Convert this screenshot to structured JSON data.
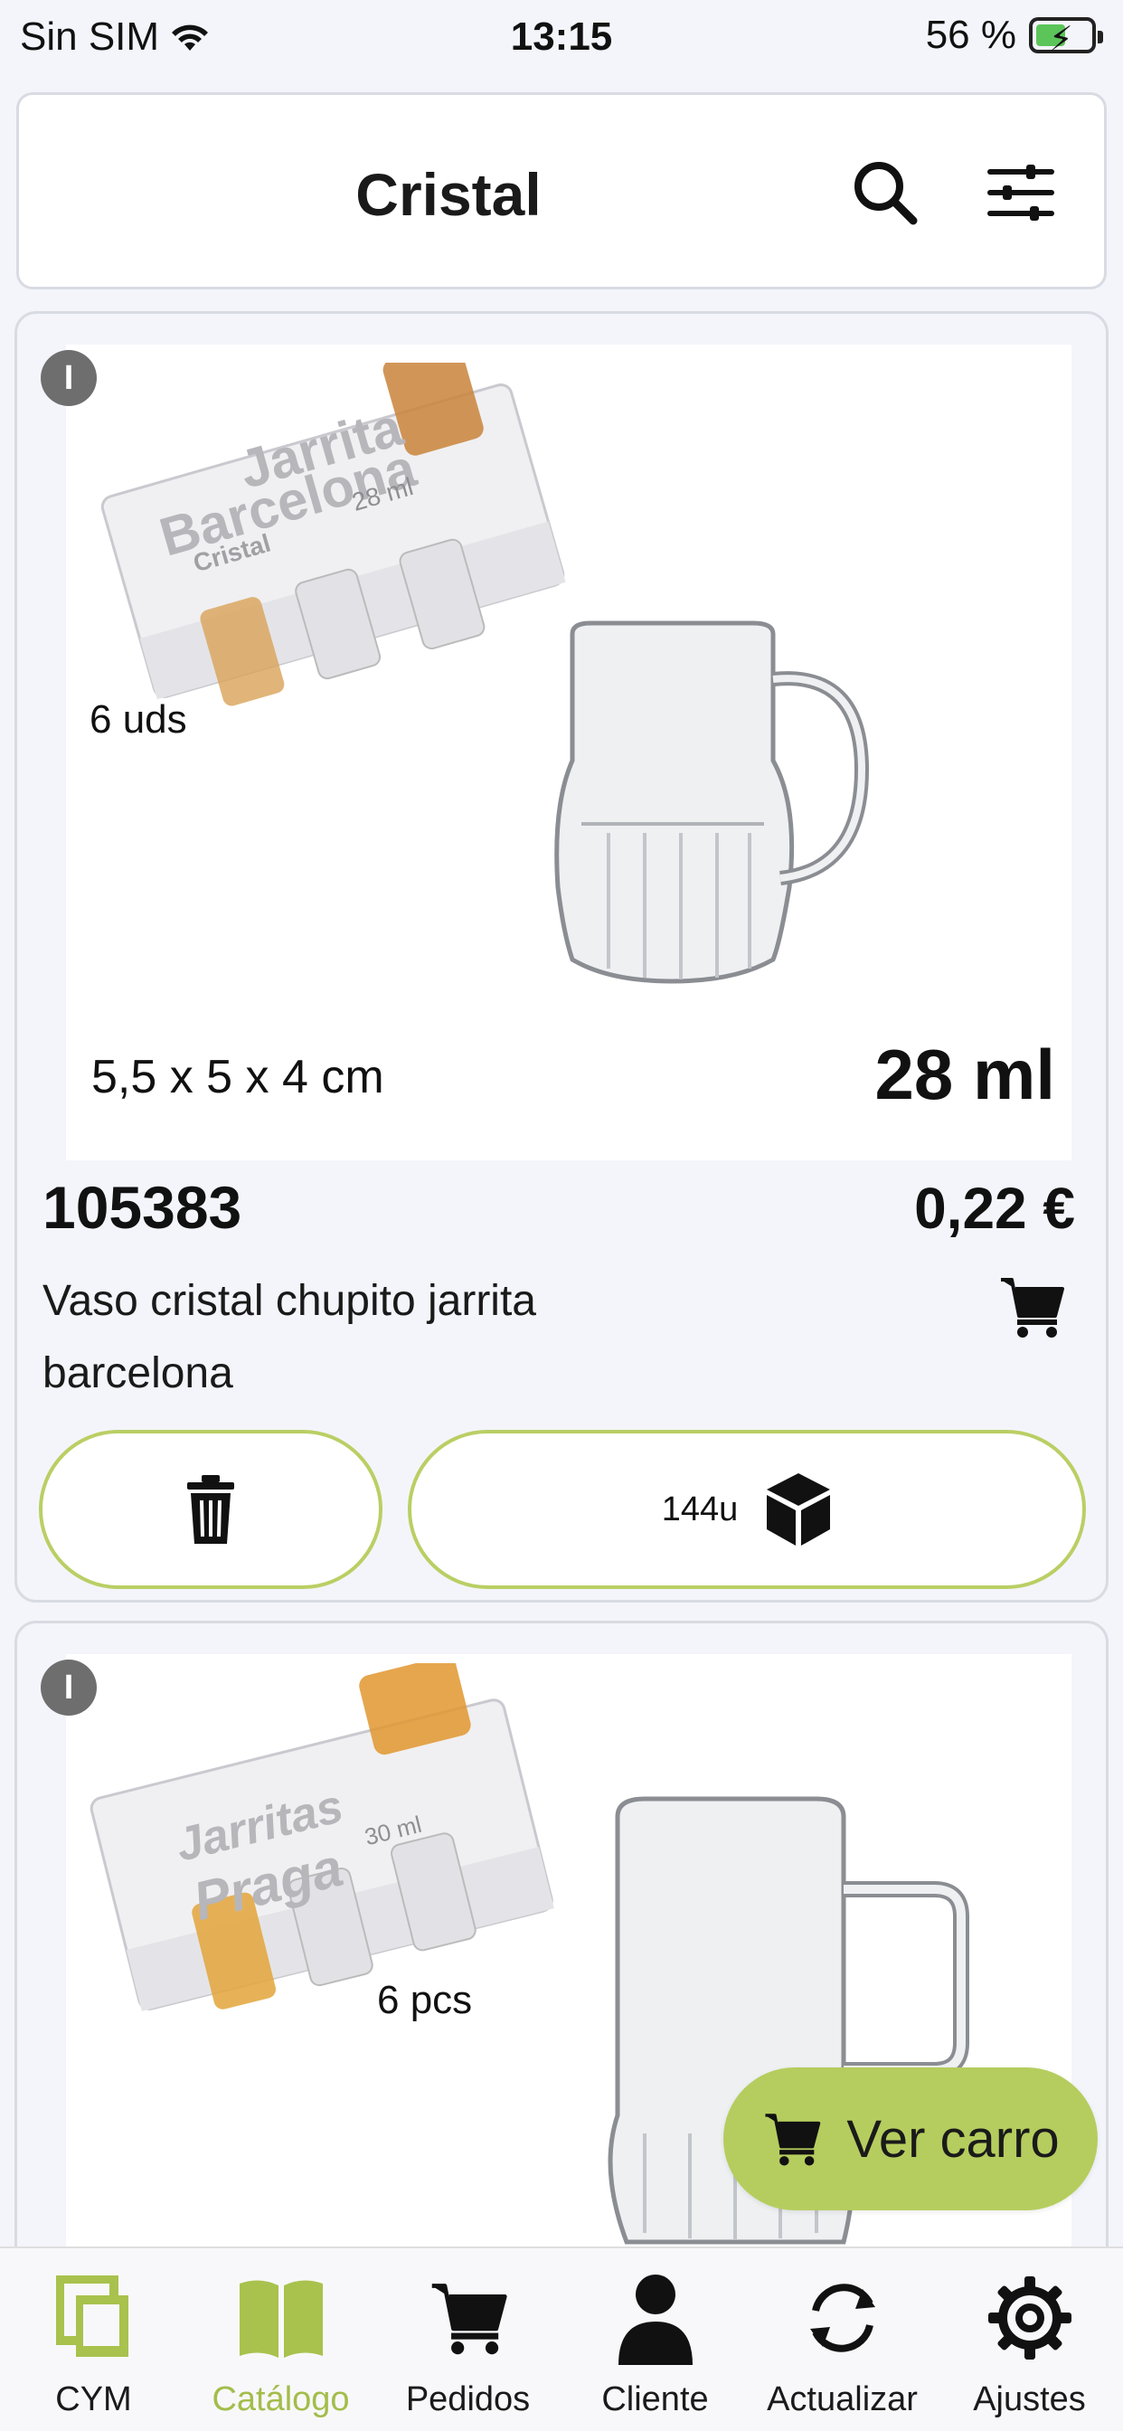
{
  "status_bar": {
    "carrier": "Sin SIM",
    "time": "13:15",
    "battery": "56 %"
  },
  "header": {
    "title": "Cristal",
    "search_icon": "search-icon",
    "filter_icon": "sliders-icon"
  },
  "products": [
    {
      "info_badge": "I",
      "image_texts": {
        "box_name_line1": "Jarrita",
        "box_name_line2": "Barcelona",
        "box_material": "Cristal",
        "box_volume": "28 ml",
        "units": "6 uds",
        "dimensions": "5,5 x 5 x 4 cm",
        "volume": "28 ml"
      },
      "code": "105383",
      "price": "0,22 €",
      "description": "Vaso cristal chupito jarrita barcelona",
      "quantity": "144u",
      "delete_icon": "trash-icon",
      "box_icon": "box-icon",
      "cart_icon": "cart-icon"
    },
    {
      "info_badge": "I",
      "image_texts": {
        "box_name_line1": "Jarritas",
        "box_name_line2": "Praga",
        "box_volume": "30 ml",
        "units": "6 pcs"
      }
    }
  ],
  "floating_button": {
    "label": "Ver carro",
    "icon": "cart-icon"
  },
  "tabbar": {
    "items": [
      {
        "label": "CYM",
        "icon": "cym-logo-icon",
        "active": false
      },
      {
        "label": "Catálogo",
        "icon": "book-icon",
        "active": true
      },
      {
        "label": "Pedidos",
        "icon": "cart-icon",
        "active": false
      },
      {
        "label": "Cliente",
        "icon": "user-icon",
        "active": false
      },
      {
        "label": "Actualizar",
        "icon": "refresh-icon",
        "active": false
      },
      {
        "label": "Ajustes",
        "icon": "gear-icon",
        "active": false
      }
    ]
  },
  "colors": {
    "accent": "#b5cd5e",
    "accent_text": "#a3bd4a",
    "background": "#f4f5fb"
  }
}
